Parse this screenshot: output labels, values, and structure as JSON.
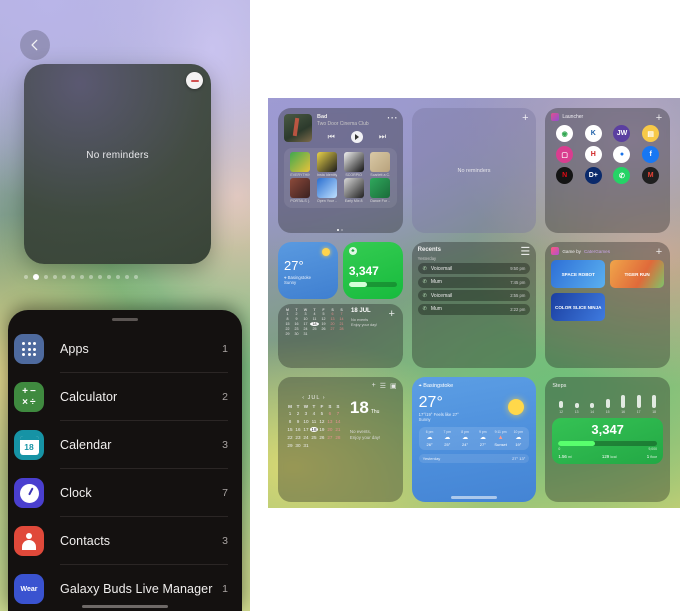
{
  "phone": {
    "back_icon": "chevron-left-icon",
    "widget": {
      "empty_text": "No reminders",
      "remove_icon": "minus-icon"
    },
    "page_dots": {
      "total": 13,
      "active_index": 1
    },
    "app_list": [
      {
        "name": "Apps",
        "count": "1",
        "icon": "apps-grid-icon",
        "color": "#4e6a9e"
      },
      {
        "name": "Calculator",
        "count": "2",
        "icon": "calculator-icon",
        "color": "#3f8a3f"
      },
      {
        "name": "Calendar",
        "count": "3",
        "icon": "calendar-icon",
        "color": "#1693a5",
        "badge": "18"
      },
      {
        "name": "Clock",
        "count": "7",
        "icon": "clock-icon",
        "color": "#4a3fcf"
      },
      {
        "name": "Contacts",
        "count": "3",
        "icon": "contacts-icon",
        "color": "#e0493a"
      },
      {
        "name": "Galaxy Buds Live Manager",
        "count": "1",
        "icon": "wear-icon",
        "color": "#3a53d0",
        "badge": "Wear"
      }
    ]
  },
  "homescreen": {
    "music_widget": {
      "track": "Bad",
      "artist": "Two Door Cinema Club",
      "prev_icon": "skip-previous-icon",
      "play_icon": "play-icon",
      "next_icon": "skip-next-icon",
      "more_icon": "more-options-icon",
      "apps": [
        {
          "label": "EVERYTHING",
          "c1": "#3fa84f",
          "c2": "#e8c23a"
        },
        {
          "label": "Insta Identity",
          "c1": "#e8d24a",
          "c2": "#1b1b1b"
        },
        {
          "label": "SCORPIO",
          "c1": "#f2f2f2",
          "c2": "#121212"
        },
        {
          "label": "Scarlett a C...",
          "c1": "#d9c9a6",
          "c2": "#b8a27c"
        },
        {
          "label": "PORTALS (...",
          "c1": "#8d4a3a",
          "c2": "#3a2020"
        },
        {
          "label": "Open Your ...",
          "c1": "#2b6fd0",
          "c2": "#bfe0ff"
        },
        {
          "label": "Early Mix 8",
          "c1": "#d8d8d8",
          "c2": "#1f1f1f"
        },
        {
          "label": "Dance For ...",
          "c1": "#2fa85c",
          "c2": "#1a6b3a"
        }
      ]
    },
    "reminders_widget": {
      "empty_text": "No reminders",
      "add_icon": "plus-icon"
    },
    "launcher_widget": {
      "title": "Launcher",
      "add_icon": "plus-icon",
      "apps": [
        {
          "name": "maps-icon",
          "glyph": "◉",
          "bg": "#ffffff",
          "fg": "#34a853"
        },
        {
          "name": "kindle-icon",
          "glyph": "K",
          "bg": "#ffffff",
          "fg": "#1d5fa8"
        },
        {
          "name": "jw-icon",
          "glyph": "JW",
          "bg": "#5b3fa0",
          "fg": "#ffffff"
        },
        {
          "name": "docs-icon",
          "glyph": "▤",
          "bg": "#f7c948",
          "fg": "#ffffff"
        },
        {
          "name": "instagram-icon",
          "glyph": "▢",
          "bg": "#d93d8f",
          "fg": "#ffffff"
        },
        {
          "name": "health-icon",
          "glyph": "H",
          "bg": "#ffffff",
          "fg": "#cf2020"
        },
        {
          "name": "chrome-icon",
          "glyph": "●",
          "bg": "#ffffff",
          "fg": "#1a73e8"
        },
        {
          "name": "facebook-icon",
          "glyph": "f",
          "bg": "#1877f2",
          "fg": "#ffffff"
        },
        {
          "name": "netflix-icon",
          "glyph": "N",
          "bg": "#141414",
          "fg": "#e50914"
        },
        {
          "name": "disney-icon",
          "glyph": "D+",
          "bg": "#0b2a6b",
          "fg": "#ffffff"
        },
        {
          "name": "whatsapp-icon",
          "glyph": "✆",
          "bg": "#25d366",
          "fg": "#ffffff"
        },
        {
          "name": "gmail-icon",
          "glyph": "M",
          "bg": "#1f1f1f",
          "fg": "#ea4335"
        }
      ]
    },
    "weather_mini": {
      "temp": "27°",
      "location": "Basingstoke",
      "condition": "Sunny",
      "pin_icon": "location-pin-icon"
    },
    "steps_mini": {
      "value": "3,347",
      "icon": "footprint-icon"
    },
    "calendar_mini": {
      "date_label": "18 JUL",
      "note_line1": "No events",
      "note_line2": "Enjoy your day!",
      "add_icon": "plus-icon",
      "weekday_headers": [
        "M",
        "T",
        "W",
        "T",
        "F",
        "S",
        "S"
      ],
      "selected_day": 18
    },
    "recents_widget": {
      "title": "Recents",
      "section": "Yesterday",
      "menu_icon": "list-icon",
      "calls": [
        {
          "name": "Voicemail",
          "time": "9:50 pm",
          "icon": "phone-icon"
        },
        {
          "name": "Mum",
          "time": "7:45 pm",
          "icon": "phone-icon"
        },
        {
          "name": "Voicemail",
          "time": "2:55 pm",
          "icon": "phone-icon"
        },
        {
          "name": "Mum",
          "time": "2:22 pm",
          "icon": "phone-icon"
        }
      ]
    },
    "games_widget": {
      "title_prefix": "Game by ",
      "title_brand": "CaterGames",
      "add_icon": "plus-icon",
      "cards": [
        {
          "label": "SPACE ROBOT",
          "style": "g1"
        },
        {
          "label": "TIGER RUN",
          "style": "g2"
        },
        {
          "label": "COLOR SLICE NINJA",
          "style": "g3"
        }
      ]
    },
    "calendar_big": {
      "month": "JUL",
      "prev_icon": "chevron-left-icon",
      "next_icon": "chevron-right-icon",
      "add_icon": "plus-icon",
      "list_icon": "list-view-icon",
      "month_icon": "month-view-icon",
      "weekday_headers": [
        "M",
        "T",
        "W",
        "T",
        "F",
        "S",
        "S"
      ],
      "selected_day": 18,
      "day_number": "18",
      "day_name": "Thu",
      "note_line1": "No events,",
      "note_line2": "Enjoy your day!"
    },
    "weather_big": {
      "location": "Basingstoke",
      "pin_icon": "location-pin-icon",
      "temp": "27°",
      "high_low": "17°/19° Feels like 27°",
      "condition": "Sunny",
      "hours": [
        {
          "time": "6 pm",
          "icon": "cloud-icon",
          "temp": "26°"
        },
        {
          "time": "7 pm",
          "icon": "cloud-icon",
          "temp": "25°"
        },
        {
          "time": "8 pm",
          "icon": "cloud-icon",
          "temp": "24°"
        },
        {
          "time": "9 pm",
          "icon": "cloud-icon",
          "temp": "27°"
        },
        {
          "time": "9:11 pm",
          "icon": "sunset-icon",
          "temp": "Sunset"
        },
        {
          "time": "10 pm",
          "icon": "cloud-icon",
          "temp": "19°"
        }
      ],
      "yesterday_label": "Yesterday",
      "yesterday_high": "27°",
      "yesterday_low": "13°"
    },
    "steps_big": {
      "title": "Steps",
      "value": "3,347",
      "goal_min": "0",
      "goal_max": "9,000",
      "progress_pct": 37,
      "bars": [
        {
          "label": "12",
          "height": 7
        },
        {
          "label": "13",
          "height": 5
        },
        {
          "label": "14",
          "height": 5
        },
        {
          "label": "15",
          "height": 9
        },
        {
          "label": "16",
          "height": 13
        },
        {
          "label": "17",
          "height": 13
        },
        {
          "label": "18",
          "height": 13
        }
      ],
      "stats": [
        {
          "value": "1.56",
          "unit": "mi"
        },
        {
          "value": "129",
          "unit": "kcal"
        },
        {
          "value": "1",
          "unit": "floor"
        }
      ]
    }
  }
}
